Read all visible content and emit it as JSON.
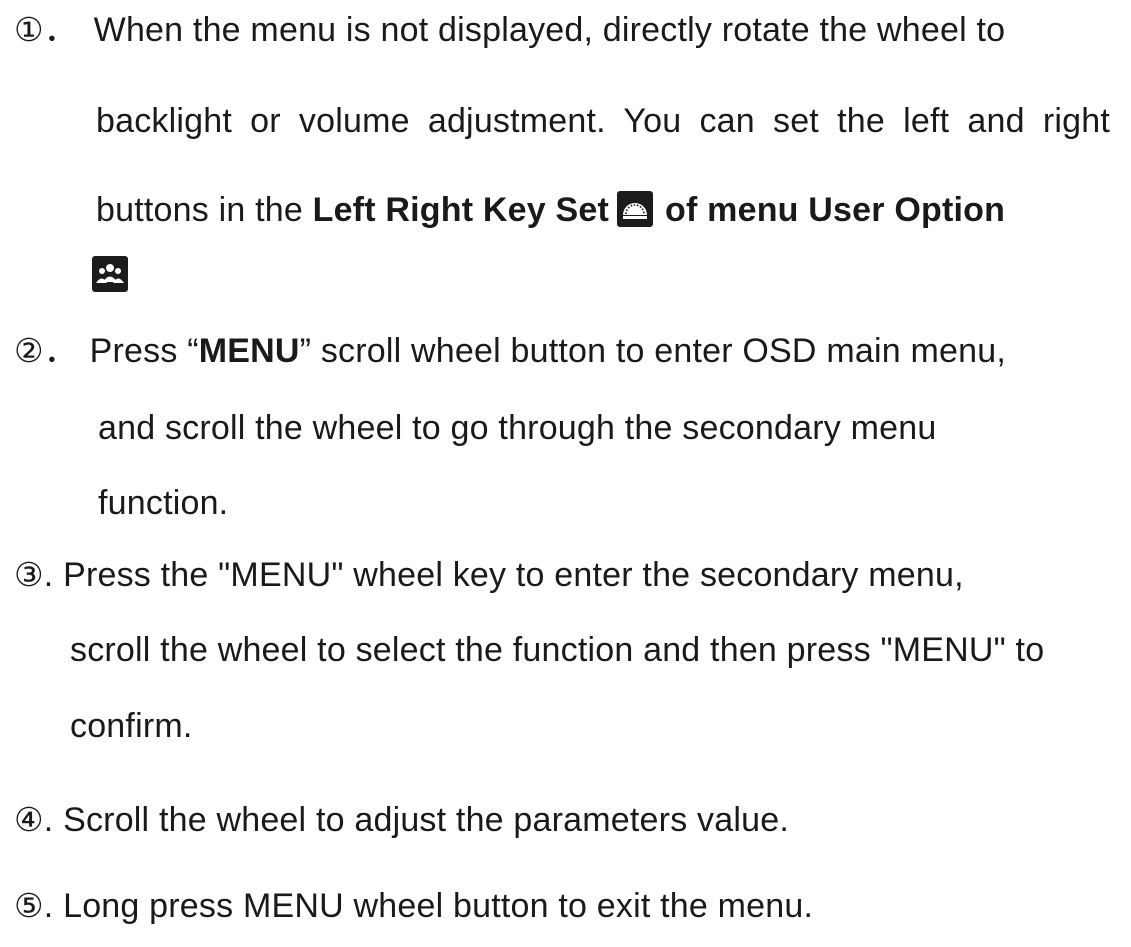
{
  "steps": [
    {
      "marker": "①",
      "lines": [
        "When the menu is not displayed, directly rotate the wheel to",
        "backlight or volume adjustment. You can set the left and right"
      ],
      "line3_prefix": "buttons in the ",
      "bold_setting": "Left Right Key Set",
      "bold_menu": "of menu User Option"
    },
    {
      "marker": "②",
      "prefix": "Press “",
      "bold_key": "MENU",
      "suffix": "” scroll wheel button to enter OSD main menu,",
      "lines": [
        "and scroll the wheel to go through the secondary menu",
        "function."
      ]
    },
    {
      "marker": "③",
      "lines": [
        ". Press the \"MENU\" wheel key to enter the secondary menu,",
        "scroll the wheel to select the function and then press \"MENU\" to",
        "confirm."
      ]
    },
    {
      "marker": "④",
      "text": ". Scroll the wheel to adjust the parameters value."
    },
    {
      "marker": "⑤",
      "text": ". Long press MENU wheel button to exit the menu."
    }
  ],
  "sep_wide": "．",
  "icons": {
    "left_right_key_set": "speedometer-dial-icon",
    "user_option": "users-group-icon"
  }
}
